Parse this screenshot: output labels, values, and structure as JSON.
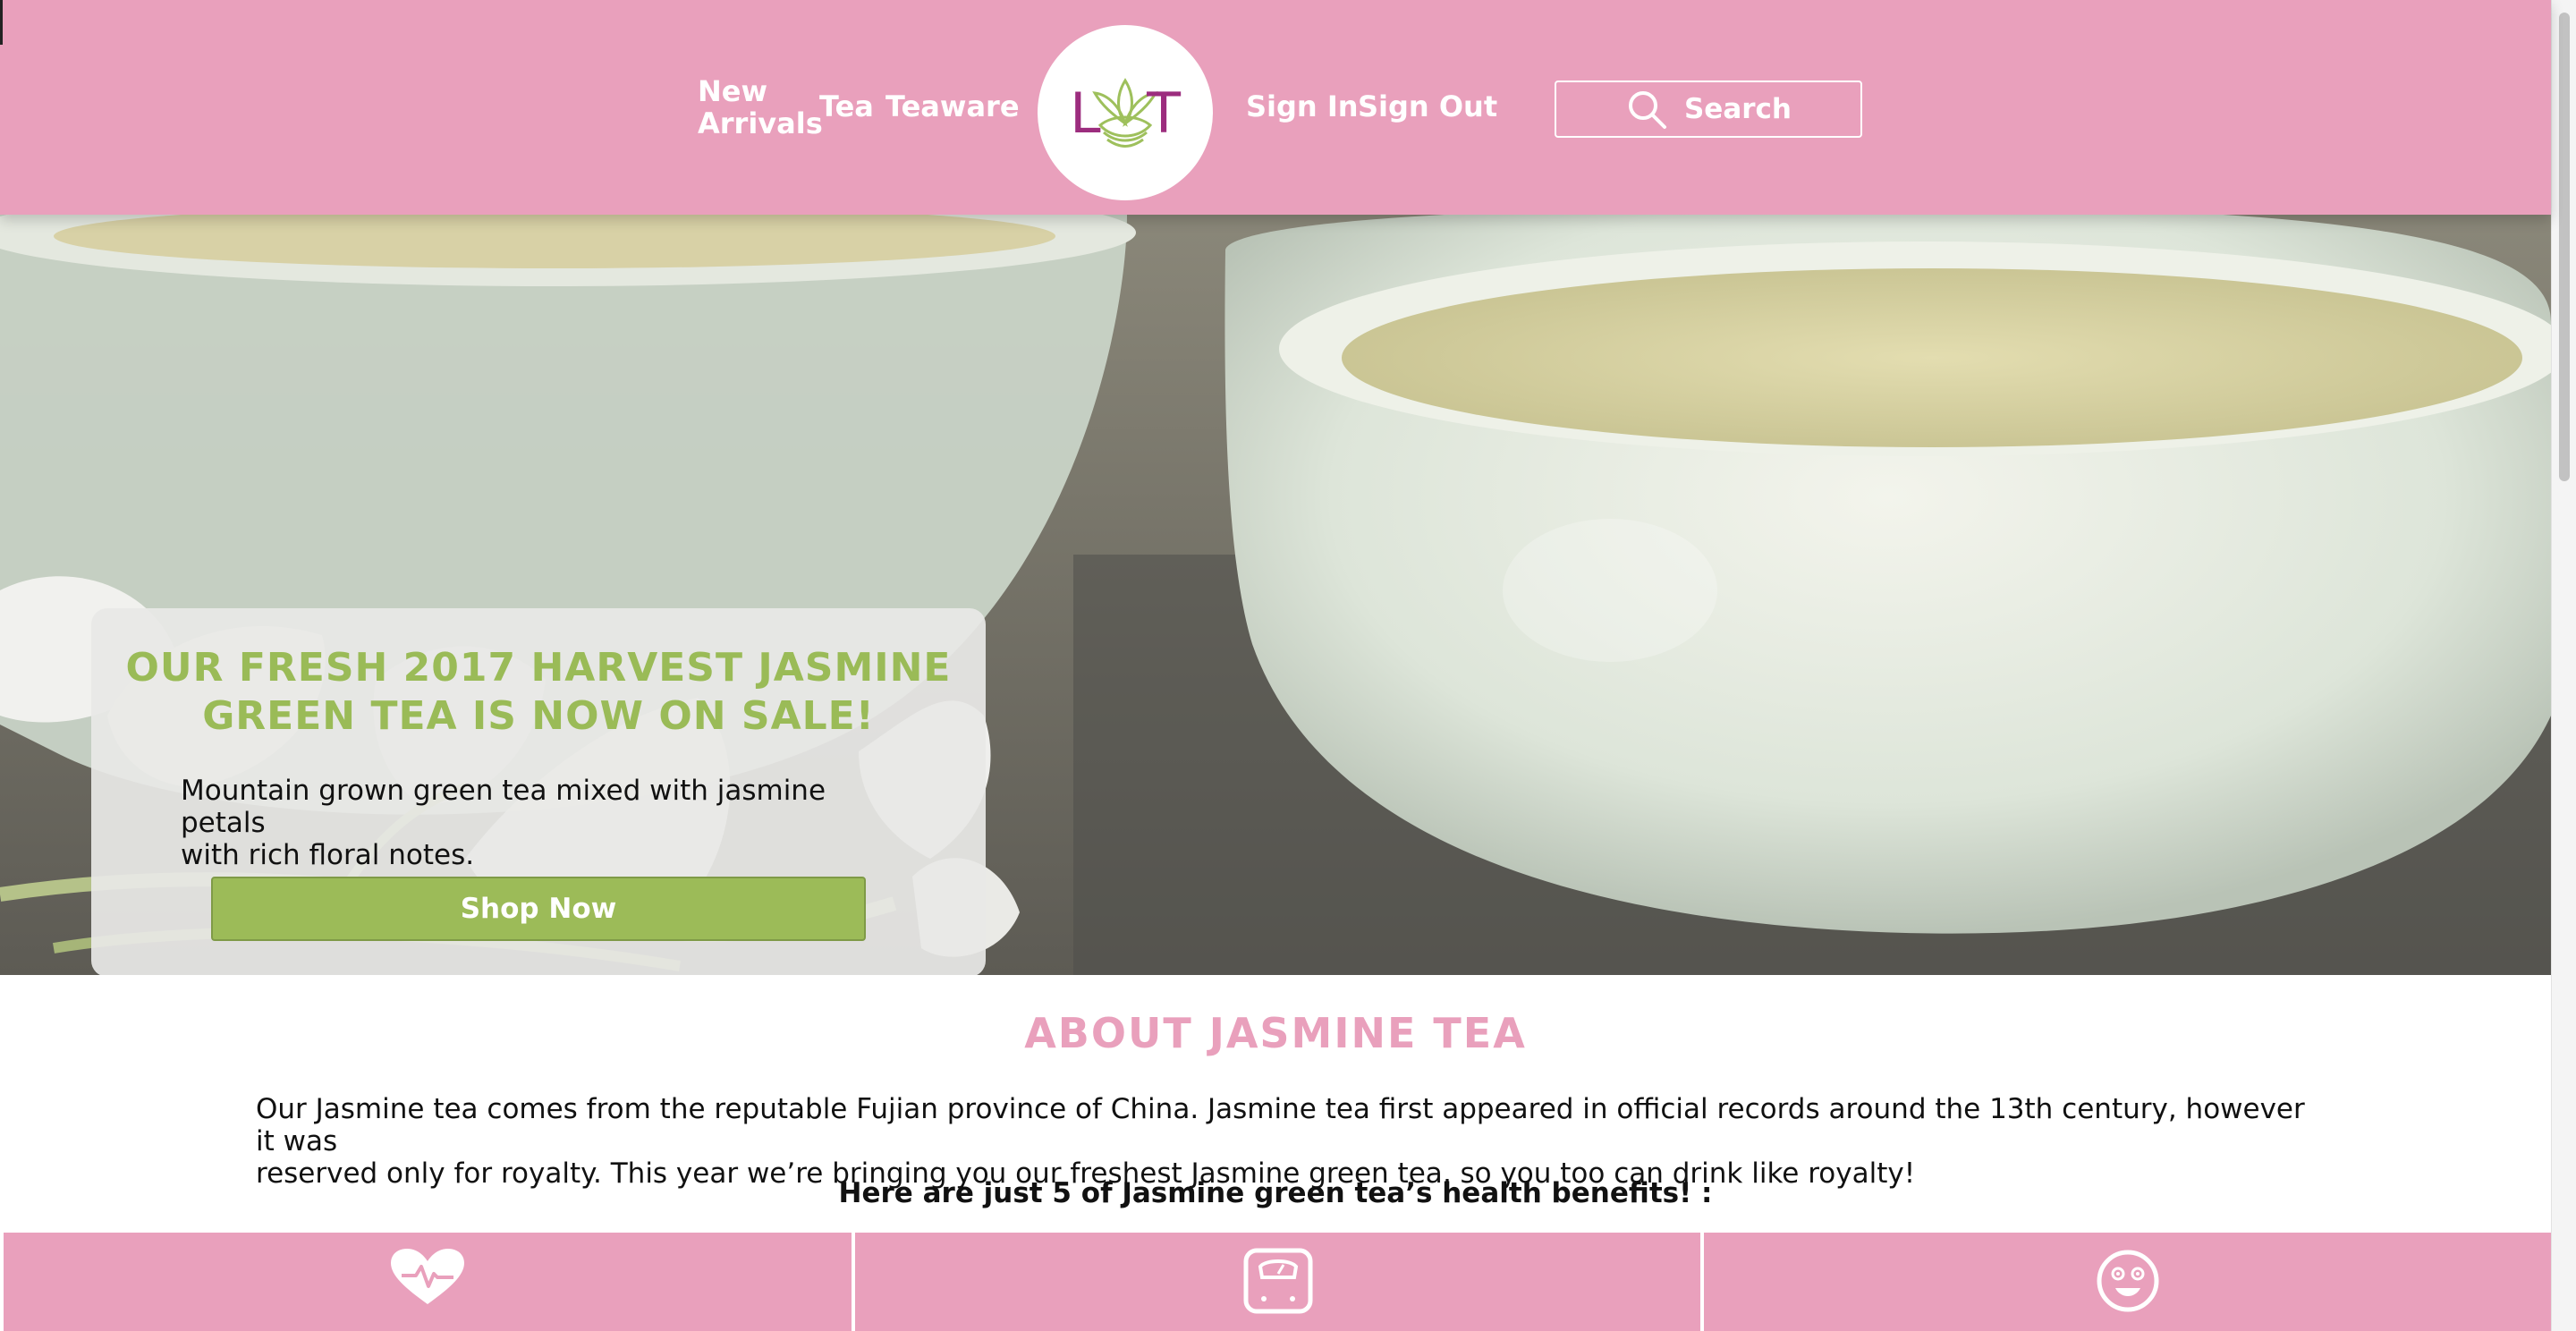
{
  "header": {
    "nav_new_line1": "New",
    "nav_new_line2": "Arrivals",
    "nav_tea": "Tea",
    "nav_teaware": "Teaware",
    "nav_signin": "Sign In",
    "nav_signout": "Sign Out",
    "logo_text": "LT",
    "search_label": "Search",
    "search_icon": "magnifier-icon"
  },
  "hero": {
    "title_line1": "OUR FRESH 2017 HARVEST JASMINE",
    "title_line2": "GREEN TEA IS NOW ON SALE!",
    "desc_line1": "Mountain grown green tea mixed with jasmine petals",
    "desc_line2": "with rich floral notes.",
    "cta_label": "Shop Now"
  },
  "about": {
    "title": "ABOUT JASMINE TEA",
    "text_line1": "Our Jasmine tea comes from the reputable Fujian province of China. Jasmine tea first appeared in official records around the 13th century, however it was",
    "text_line2": "reserved only for royalty. This year we’re bringing you our freshest Jasmine green tea, so you too can drink like royalty!",
    "benefits_intro": "Here are just 5 of Jasmine green tea’s health benefits! :"
  },
  "benefits": {
    "icons": [
      "heart-icon",
      "scale-icon",
      "smiley-icon"
    ]
  },
  "colors": {
    "brand_pink": "#e9a0bc",
    "brand_green": "#9cbb58",
    "logo_purple": "#9c2d7e"
  }
}
